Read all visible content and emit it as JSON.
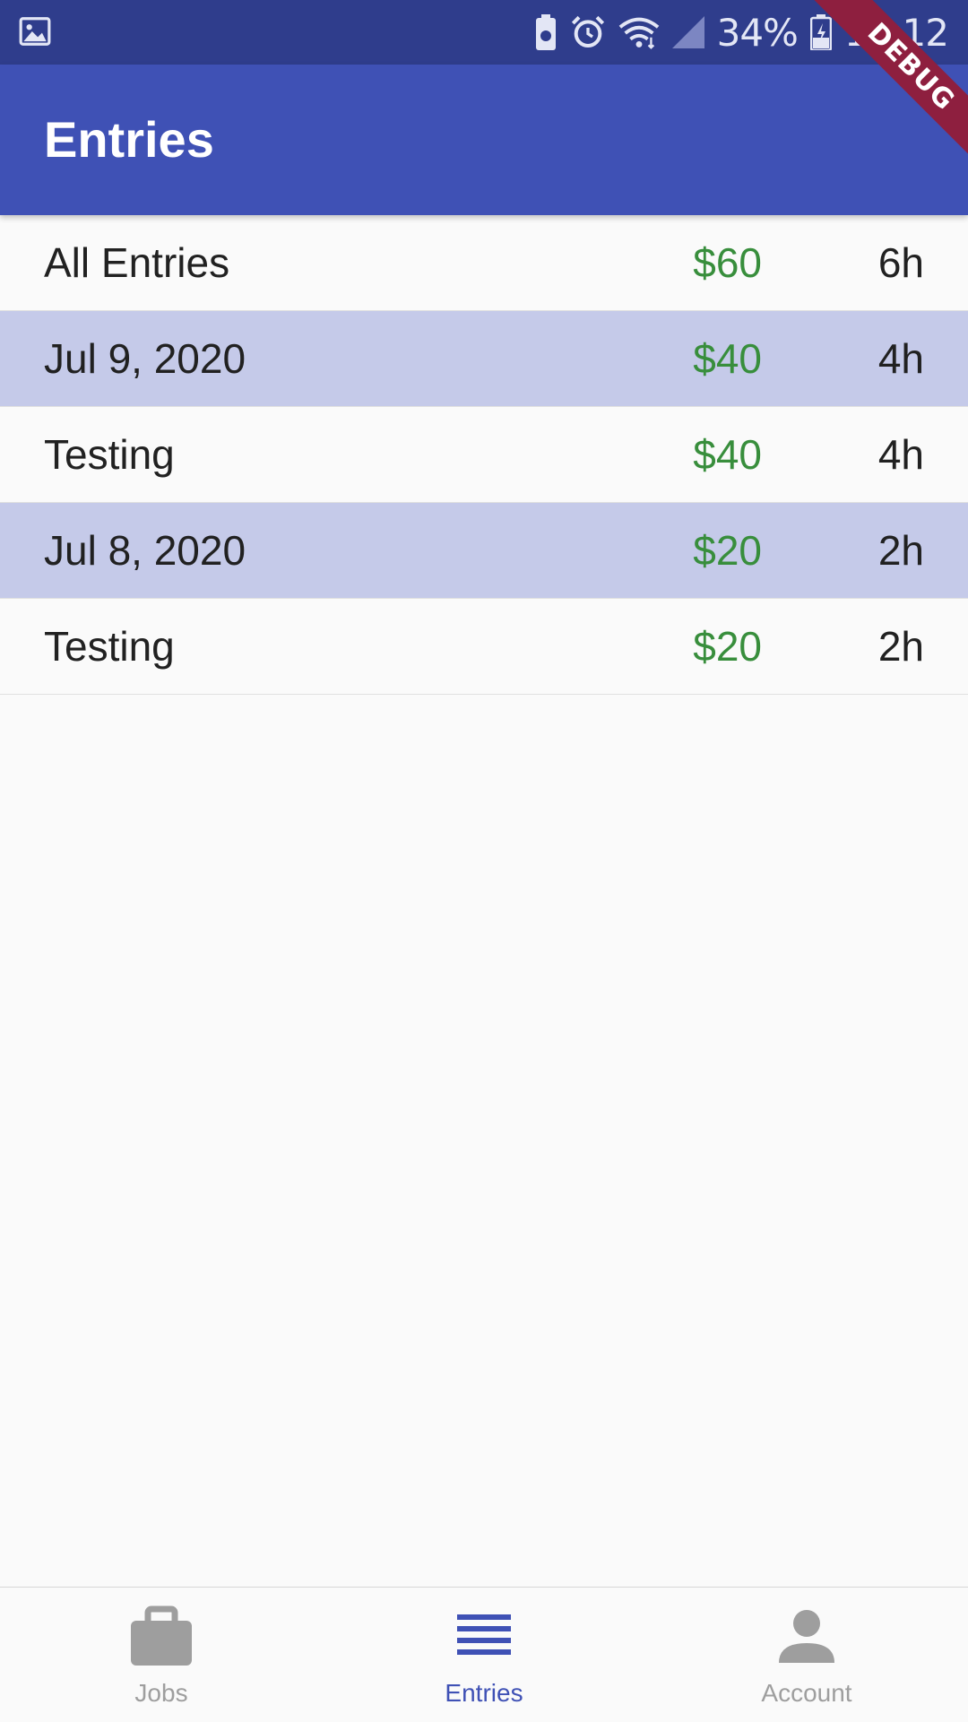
{
  "status_bar": {
    "icons": [
      "image-icon",
      "battery-saver-icon",
      "alarm-icon",
      "wifi-icon",
      "cellular-signal-icon",
      "battery-charging-icon"
    ],
    "battery_percent": "34%",
    "time": "10:12"
  },
  "app_bar": {
    "title": "Entries"
  },
  "debug_banner": {
    "label": "DEBUG"
  },
  "entries": [
    {
      "label": "All Entries",
      "pay": "$60",
      "hours": "6h",
      "type": "total"
    },
    {
      "label": "Jul 9, 2020",
      "pay": "$40",
      "hours": "4h",
      "type": "date"
    },
    {
      "label": "Testing",
      "pay": "$40",
      "hours": "4h",
      "type": "job"
    },
    {
      "label": "Jul 8, 2020",
      "pay": "$20",
      "hours": "2h",
      "type": "date"
    },
    {
      "label": "Testing",
      "pay": "$20",
      "hours": "2h",
      "type": "job"
    }
  ],
  "bottom_nav": {
    "items": [
      {
        "label": "Jobs",
        "icon": "briefcase-icon",
        "active": false
      },
      {
        "label": "Entries",
        "icon": "list-icon",
        "active": true
      },
      {
        "label": "Account",
        "icon": "person-icon",
        "active": false
      }
    ]
  },
  "colors": {
    "primary": "#3f51b5",
    "primary_dark": "#2f3d8c",
    "date_row_bg": "#c5cae9",
    "pay_text": "#388e3c",
    "inactive_nav": "#9e9e9e"
  }
}
